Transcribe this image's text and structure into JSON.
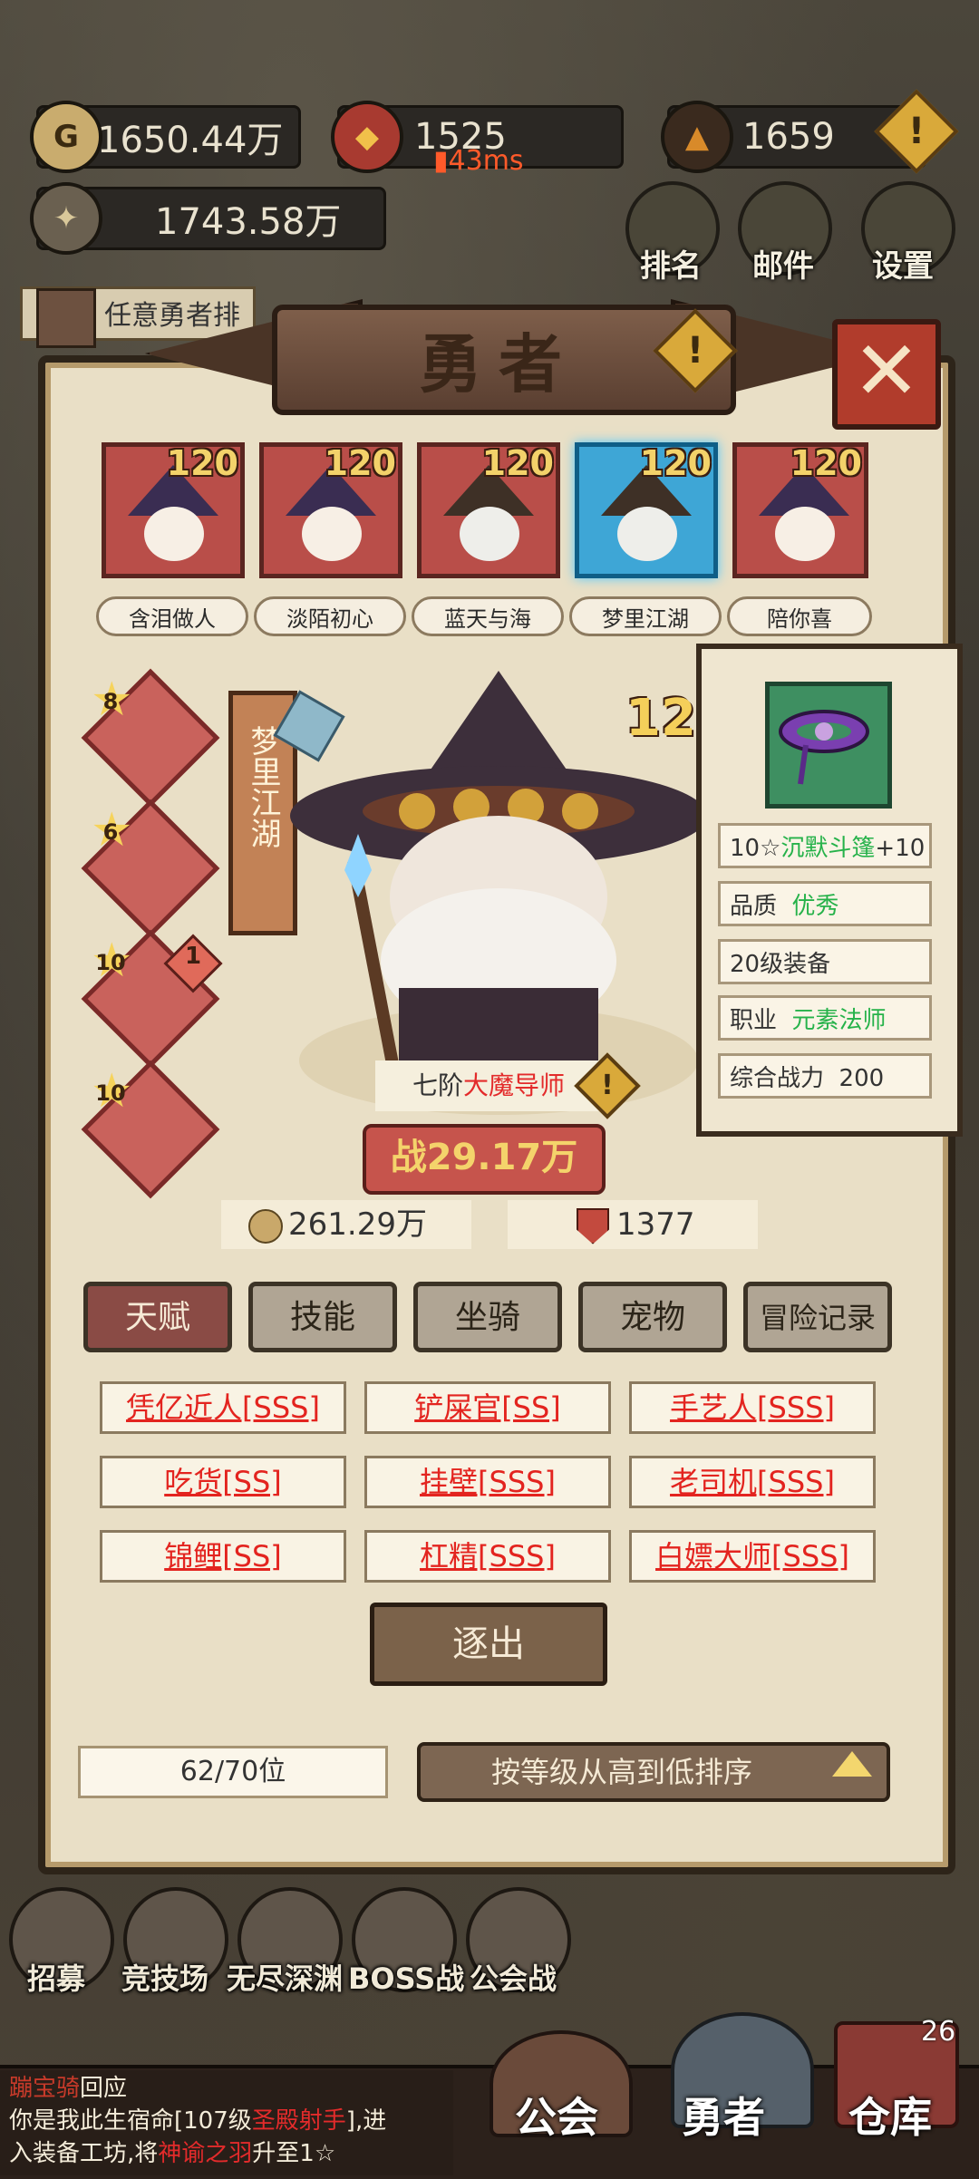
{
  "top_bar": {
    "gold": "1650.44万",
    "gems": "1525",
    "ping": "43ms",
    "orb": "1659",
    "total_power": "1743.58万",
    "task_hint": "任意勇者排",
    "rank_label": "排名",
    "mail_label": "邮件",
    "settings_label": "设置"
  },
  "panel": {
    "title": "勇者",
    "close": "✕"
  },
  "heroes": [
    {
      "name": "含泪做人",
      "level": "120"
    },
    {
      "name": "淡陌初心",
      "level": "120"
    },
    {
      "name": "蓝天与海",
      "level": "120"
    },
    {
      "name": "梦里江湖",
      "level": "120"
    },
    {
      "name": "陪你喜",
      "level": "120"
    }
  ],
  "equipment": [
    {
      "stars": "8"
    },
    {
      "stars": "6"
    },
    {
      "stars": "10",
      "badge": "1"
    },
    {
      "stars": "10"
    }
  ],
  "selected_hero": {
    "name": "梦里江湖",
    "level_partial": "12",
    "rank_prefix": "七阶",
    "rank_class": "大魔导师",
    "power_prefix": "战",
    "power": "29.17万",
    "gold": "261.29万",
    "honor": "1377"
  },
  "item_detail": {
    "name_prefix": "10☆",
    "name": "沉默斗篷",
    "name_suffix": "+10",
    "quality_label": "品质",
    "quality": "优秀",
    "level": "20级装备",
    "class_label": "职业",
    "class": "元素法师",
    "power_label": "综合战力",
    "power": "200"
  },
  "tabs": [
    "天赋",
    "技能",
    "坐骑",
    "宠物",
    "冒险记录"
  ],
  "traits": [
    "凭亿近人[SSS]",
    "铲屎官[SS]",
    "手艺人[SSS]",
    "吃货[SS]",
    "挂壁[SSS]",
    "老司机[SSS]",
    "锦鲤[SS]",
    "杠精[SSS]",
    "白嫖大师[SSS]"
  ],
  "expel_label": "逐出",
  "count": "62/70位",
  "sort_label": "按等级从高到低排序",
  "bottom_icons": [
    "招募",
    "竞技场",
    "无尽深渊",
    "BOSS战",
    "公会战"
  ],
  "message": {
    "speaker": "蹦宝骑",
    "speaker_suffix": "回应",
    "line1": "你是我此生宿命[107级",
    "line1_hl": "圣殿射手",
    "line1_end": "],进",
    "line2": "入装备工坊,将",
    "line2_hl": "神谕之羽",
    "line2_end": "升至1☆"
  },
  "nav": {
    "guild": "公会",
    "hero": "勇者",
    "warehouse": "仓库",
    "warehouse_badge": "26"
  },
  "colors": {
    "accent_red": "#e32b2b",
    "quality_green": "#26b24a",
    "panel_bg": "#e9dfc6"
  }
}
